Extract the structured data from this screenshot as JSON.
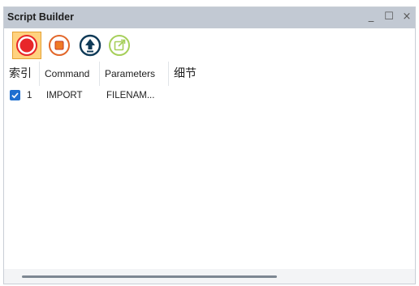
{
  "window": {
    "title": "Script Builder",
    "controls": {
      "minimize": "_",
      "maximize": "☐",
      "close": "×"
    }
  },
  "toolbar": {
    "buttons": [
      {
        "name": "record",
        "icon": "record-icon",
        "active": true,
        "color": "#e8262a"
      },
      {
        "name": "stop",
        "icon": "stop-icon",
        "active": false,
        "color": "#e2672a"
      },
      {
        "name": "upload",
        "icon": "upload-arrow-icon",
        "active": false,
        "color": "#0f3a57"
      },
      {
        "name": "export",
        "icon": "external-link-icon",
        "active": false,
        "color": "#a6cf5a"
      }
    ]
  },
  "table": {
    "columns": [
      "索引",
      "Command",
      "Parameters",
      "细节"
    ],
    "rows": [
      {
        "checked": true,
        "index": "1",
        "command": "IMPORT",
        "parameters": "FILENAM...",
        "details": ""
      }
    ]
  },
  "colors": {
    "titlebar": "#c2c9d3",
    "accent": "#1f6fd0",
    "active_button": "#ffd27f"
  }
}
